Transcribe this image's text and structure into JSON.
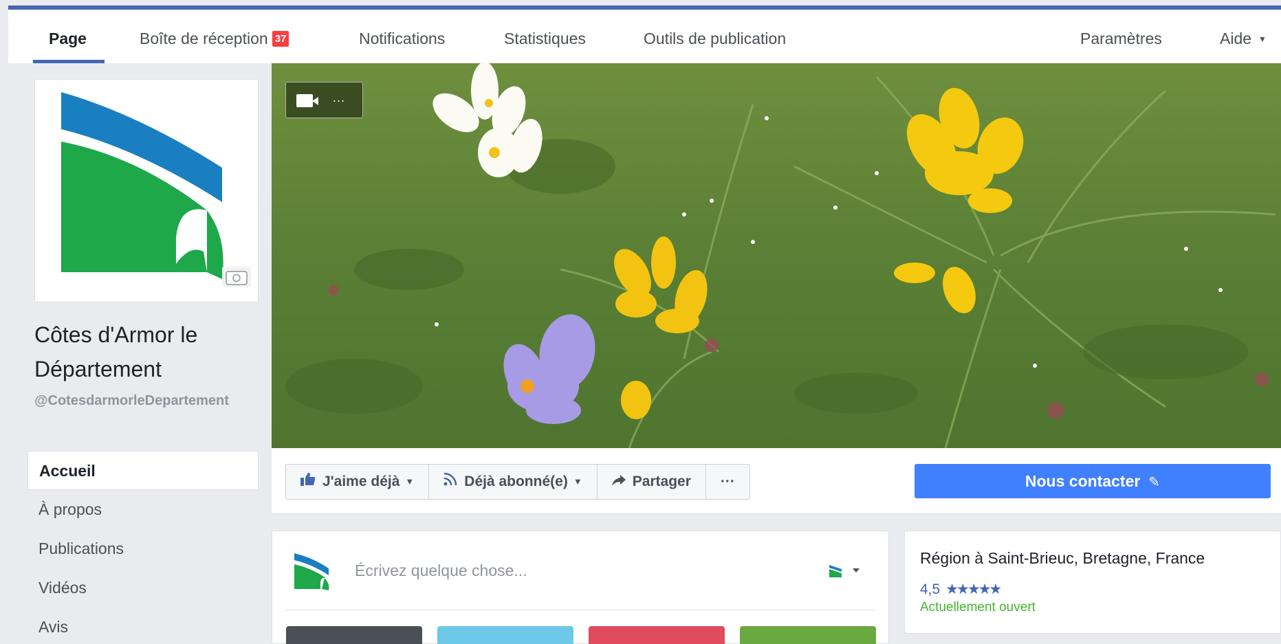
{
  "nav": {
    "tabs": [
      {
        "label": "Page"
      },
      {
        "label": "Boîte de réception",
        "badge": "37"
      },
      {
        "label": "Notifications"
      },
      {
        "label": "Statistiques"
      },
      {
        "label": "Outils de publication"
      }
    ],
    "right": {
      "settings": "Paramètres",
      "help": "Aide"
    }
  },
  "page": {
    "name": "Côtes d'Armor le Département",
    "handle": "@CotesdarmorleDepartement"
  },
  "sidebar": {
    "items": [
      {
        "label": "Accueil"
      },
      {
        "label": "À propos"
      },
      {
        "label": "Publications"
      },
      {
        "label": "Vidéos"
      },
      {
        "label": "Avis"
      }
    ]
  },
  "cover": {
    "video_dots": "..."
  },
  "actions": {
    "like": "J'aime déjà",
    "follow": "Déjà abonné(e)",
    "share": "Partager",
    "more": "···",
    "contact": "Nous contacter"
  },
  "composer": {
    "placeholder": "Écrivez quelque chose..."
  },
  "info": {
    "region": "Région à Saint-Brieuc, Bretagne, France",
    "rating": "4,5",
    "stars": "★★★★★",
    "status": "Actuellement ouvert"
  },
  "colors": {
    "brand_blue": "#4267b2",
    "contact_blue": "#4080ff",
    "badge_red": "#fa3e3e",
    "open_green": "#42b72a",
    "logo_blue": "#1a7fc1",
    "logo_green": "#1fa84a"
  },
  "icons": [
    "video-camera-icon",
    "camera-icon",
    "thumbs-up-icon",
    "rss-icon",
    "share-arrow-icon",
    "pencil-icon",
    "chevron-down-icon",
    "star-icon"
  ]
}
